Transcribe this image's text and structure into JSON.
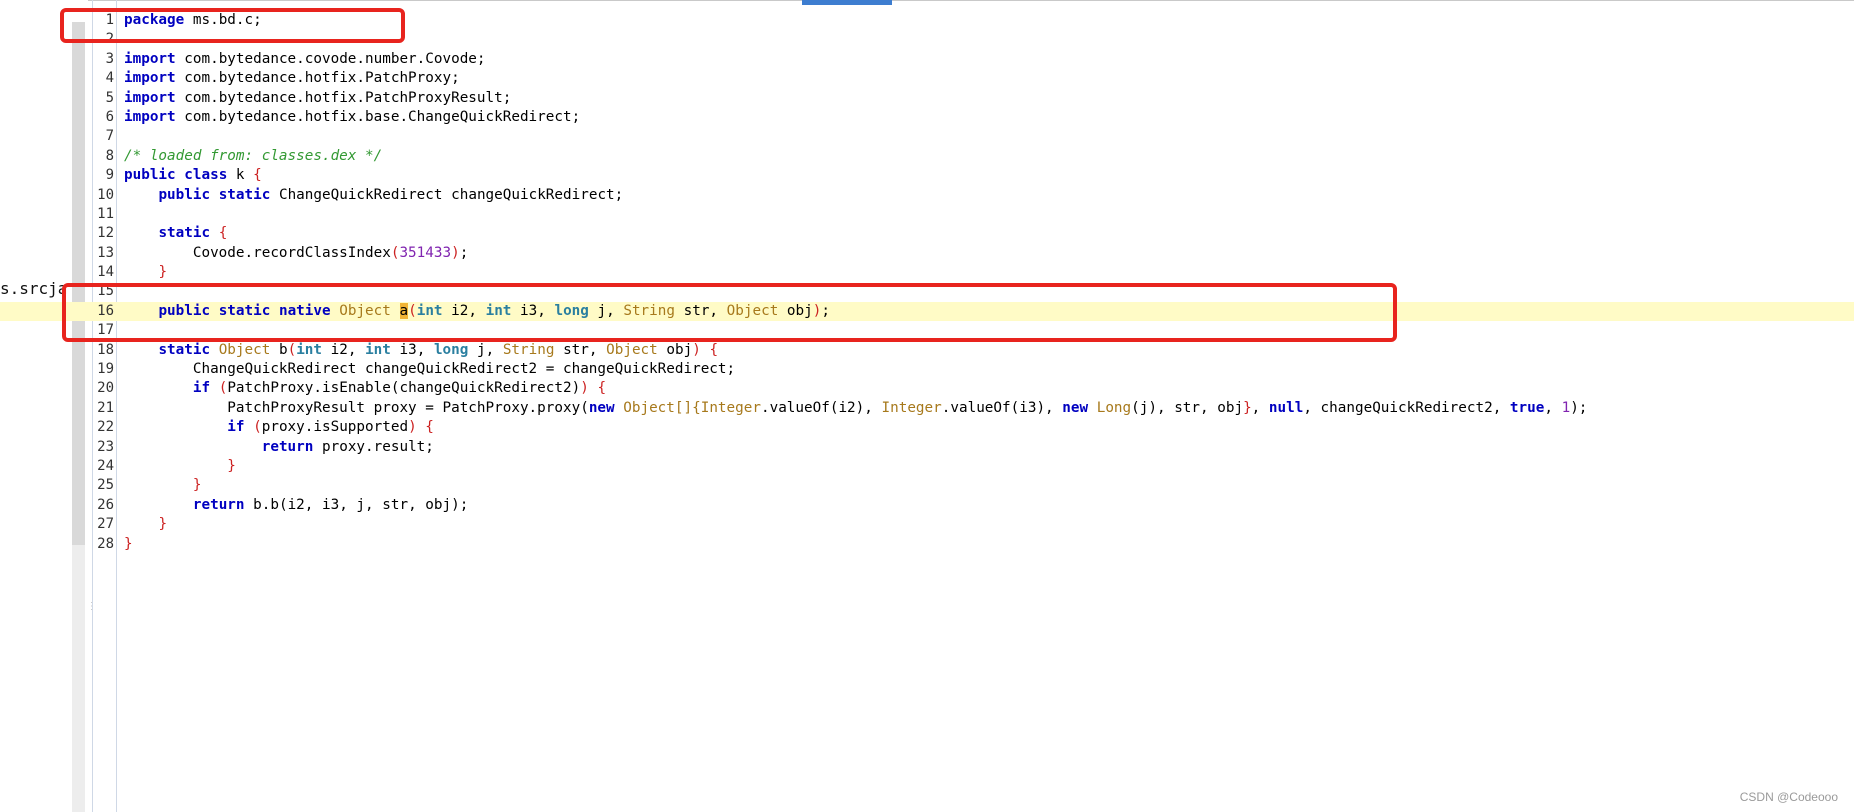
{
  "left_pane_fragment": "s.srcja",
  "watermark": "CSDN @Codeooo",
  "colors": {
    "keyword": "#0000c0",
    "type": "#a7791c",
    "primitive": "#2a7fa0",
    "brace": "#cc2222",
    "number": "#8024b0",
    "comment": "#339933",
    "highlight_line": "#fffbc6",
    "annotation_box": "#e8241e"
  },
  "code": {
    "highlighted_line": 16,
    "lines": [
      {
        "n": "1",
        "parts": [
          {
            "t": "package",
            "c": "kw"
          },
          {
            "t": " ms.bd.c;"
          }
        ]
      },
      {
        "n": "2",
        "parts": []
      },
      {
        "n": "3",
        "parts": [
          {
            "t": "import",
            "c": "kw"
          },
          {
            "t": " com.bytedance.covode.number.Covode;"
          }
        ]
      },
      {
        "n": "4",
        "parts": [
          {
            "t": "import",
            "c": "kw"
          },
          {
            "t": " com.bytedance.hotfix.PatchProxy;"
          }
        ]
      },
      {
        "n": "5",
        "parts": [
          {
            "t": "import",
            "c": "kw"
          },
          {
            "t": " com.bytedance.hotfix.PatchProxyResult;"
          }
        ]
      },
      {
        "n": "6",
        "parts": [
          {
            "t": "import",
            "c": "kw"
          },
          {
            "t": " com.bytedance.hotfix.base.ChangeQuickRedirect;"
          }
        ]
      },
      {
        "n": "7",
        "parts": []
      },
      {
        "n": "8",
        "parts": [
          {
            "t": "/* loaded from: classes.dex */",
            "c": "cm"
          }
        ]
      },
      {
        "n": "9",
        "parts": [
          {
            "t": "public",
            "c": "kw"
          },
          {
            "t": " "
          },
          {
            "t": "class",
            "c": "kw"
          },
          {
            "t": " k "
          },
          {
            "t": "{",
            "c": "br"
          }
        ]
      },
      {
        "n": "10",
        "parts": [
          {
            "t": "    "
          },
          {
            "t": "public",
            "c": "kw"
          },
          {
            "t": " "
          },
          {
            "t": "static",
            "c": "kw"
          },
          {
            "t": " ChangeQuickRedirect changeQuickRedirect;"
          }
        ]
      },
      {
        "n": "11",
        "parts": []
      },
      {
        "n": "12",
        "parts": [
          {
            "t": "    "
          },
          {
            "t": "static",
            "c": "kw"
          },
          {
            "t": " "
          },
          {
            "t": "{",
            "c": "br"
          }
        ]
      },
      {
        "n": "13",
        "parts": [
          {
            "t": "        Covode.recordClassIndex"
          },
          {
            "t": "(",
            "c": "br"
          },
          {
            "t": "351433",
            "c": "nm"
          },
          {
            "t": ")",
            "c": "br"
          },
          {
            "t": ";"
          }
        ]
      },
      {
        "n": "14",
        "parts": [
          {
            "t": "    "
          },
          {
            "t": "}",
            "c": "br"
          }
        ]
      },
      {
        "n": "15",
        "parts": []
      },
      {
        "n": "16",
        "parts": [
          {
            "t": "    "
          },
          {
            "t": "public",
            "c": "kw"
          },
          {
            "t": " "
          },
          {
            "t": "static",
            "c": "kw"
          },
          {
            "t": " "
          },
          {
            "t": "native",
            "c": "kw"
          },
          {
            "t": " "
          },
          {
            "t": "Object",
            "c": "ty"
          },
          {
            "t": " "
          },
          {
            "t": "a",
            "c": "sel"
          },
          {
            "t": "(",
            "c": "br"
          },
          {
            "t": "int",
            "c": "pt"
          },
          {
            "t": " i2, "
          },
          {
            "t": "int",
            "c": "pt"
          },
          {
            "t": " i3, "
          },
          {
            "t": "long",
            "c": "pt"
          },
          {
            "t": " j, "
          },
          {
            "t": "String",
            "c": "ty"
          },
          {
            "t": " str, "
          },
          {
            "t": "Object",
            "c": "ty"
          },
          {
            "t": " obj"
          },
          {
            "t": ")",
            "c": "br"
          },
          {
            "t": ";"
          }
        ]
      },
      {
        "n": "17",
        "parts": []
      },
      {
        "n": "18",
        "parts": [
          {
            "t": "    "
          },
          {
            "t": "static",
            "c": "kw"
          },
          {
            "t": " "
          },
          {
            "t": "Object",
            "c": "ty"
          },
          {
            "t": " b"
          },
          {
            "t": "(",
            "c": "br"
          },
          {
            "t": "int",
            "c": "pt"
          },
          {
            "t": " i2, "
          },
          {
            "t": "int",
            "c": "pt"
          },
          {
            "t": " i3, "
          },
          {
            "t": "long",
            "c": "pt"
          },
          {
            "t": " j, "
          },
          {
            "t": "String",
            "c": "ty"
          },
          {
            "t": " str, "
          },
          {
            "t": "Object",
            "c": "ty"
          },
          {
            "t": " obj"
          },
          {
            "t": ")",
            "c": "br"
          },
          {
            "t": " "
          },
          {
            "t": "{",
            "c": "br"
          }
        ]
      },
      {
        "n": "19",
        "parts": [
          {
            "t": "        ChangeQuickRedirect changeQuickRedirect2 = changeQuickRedirect;"
          }
        ]
      },
      {
        "n": "20",
        "parts": [
          {
            "t": "        "
          },
          {
            "t": "if",
            "c": "kw"
          },
          {
            "t": " "
          },
          {
            "t": "(",
            "c": "br"
          },
          {
            "t": "PatchProxy.isEnable(changeQuickRedirect2)"
          },
          {
            "t": ")",
            "c": "br"
          },
          {
            "t": " "
          },
          {
            "t": "{",
            "c": "br"
          }
        ]
      },
      {
        "n": "21",
        "parts": [
          {
            "t": "            PatchProxyResult proxy = PatchProxy.proxy("
          },
          {
            "t": "new",
            "c": "kw"
          },
          {
            "t": " "
          },
          {
            "t": "Object[]{",
            "c": "ty"
          },
          {
            "t": "Integer",
            "c": "ty"
          },
          {
            "t": ".valueOf(i2), "
          },
          {
            "t": "Integer",
            "c": "ty"
          },
          {
            "t": ".valueOf(i3), "
          },
          {
            "t": "new",
            "c": "kw"
          },
          {
            "t": " "
          },
          {
            "t": "Long",
            "c": "ty"
          },
          {
            "t": "(j), str, obj"
          },
          {
            "t": "}",
            "c": "br"
          },
          {
            "t": ", "
          },
          {
            "t": "null",
            "c": "kw"
          },
          {
            "t": ", changeQuickRedirect2, "
          },
          {
            "t": "true",
            "c": "kw"
          },
          {
            "t": ", "
          },
          {
            "t": "1",
            "c": "nm"
          },
          {
            "t": ");"
          }
        ]
      },
      {
        "n": "22",
        "parts": [
          {
            "t": "            "
          },
          {
            "t": "if",
            "c": "kw"
          },
          {
            "t": " "
          },
          {
            "t": "(",
            "c": "br"
          },
          {
            "t": "proxy.isSupported"
          },
          {
            "t": ")",
            "c": "br"
          },
          {
            "t": " "
          },
          {
            "t": "{",
            "c": "br"
          }
        ]
      },
      {
        "n": "23",
        "parts": [
          {
            "t": "                "
          },
          {
            "t": "return",
            "c": "kw"
          },
          {
            "t": " proxy.result;"
          }
        ]
      },
      {
        "n": "24",
        "parts": [
          {
            "t": "            "
          },
          {
            "t": "}",
            "c": "br"
          }
        ]
      },
      {
        "n": "25",
        "parts": [
          {
            "t": "        "
          },
          {
            "t": "}",
            "c": "br"
          }
        ]
      },
      {
        "n": "26",
        "parts": [
          {
            "t": "        "
          },
          {
            "t": "return",
            "c": "kw"
          },
          {
            "t": " b.b(i2, i3, j, str, obj);"
          }
        ]
      },
      {
        "n": "27",
        "parts": [
          {
            "t": "    "
          },
          {
            "t": "}",
            "c": "br"
          }
        ]
      },
      {
        "n": "28",
        "parts": [
          {
            "t": "}",
            "c": "br"
          }
        ]
      }
    ]
  }
}
